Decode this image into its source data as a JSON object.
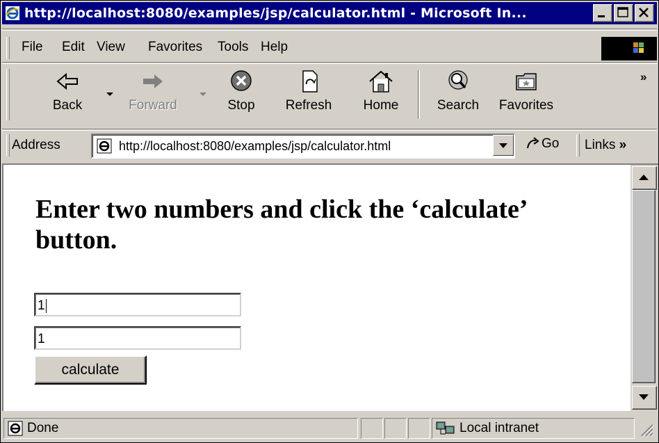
{
  "window": {
    "title": "http://localhost:8080/examples/jsp/calculator.html - Microsoft In...",
    "minimize": "_",
    "maximize": "□",
    "close": "✕"
  },
  "menu": {
    "items": [
      "File",
      "Edit",
      "View",
      "Favorites",
      "Tools",
      "Help"
    ]
  },
  "toolbar": {
    "back": "Back",
    "forward": "Forward",
    "stop": "Stop",
    "refresh": "Refresh",
    "home": "Home",
    "search": "Search",
    "favorites": "Favorites",
    "more": "»"
  },
  "address": {
    "label": "Address",
    "url": "http://localhost:8080/examples/jsp/calculator.html",
    "go": "Go",
    "links": "Links",
    "links_more": "»"
  },
  "page": {
    "heading": "Enter two numbers and click the ‘calculate’ button.",
    "input1": "1",
    "input2": "1",
    "button": "calculate"
  },
  "status": {
    "text": "Done",
    "zone": "Local intranet"
  },
  "colors": {
    "titlebar": "#000080",
    "chrome": "#d4d0c8"
  },
  "icons": [
    "ie-icon",
    "back-arrow-icon",
    "forward-arrow-icon",
    "stop-icon",
    "refresh-icon",
    "home-icon",
    "search-icon",
    "favorites-icon",
    "go-icon",
    "intranet-icon"
  ]
}
